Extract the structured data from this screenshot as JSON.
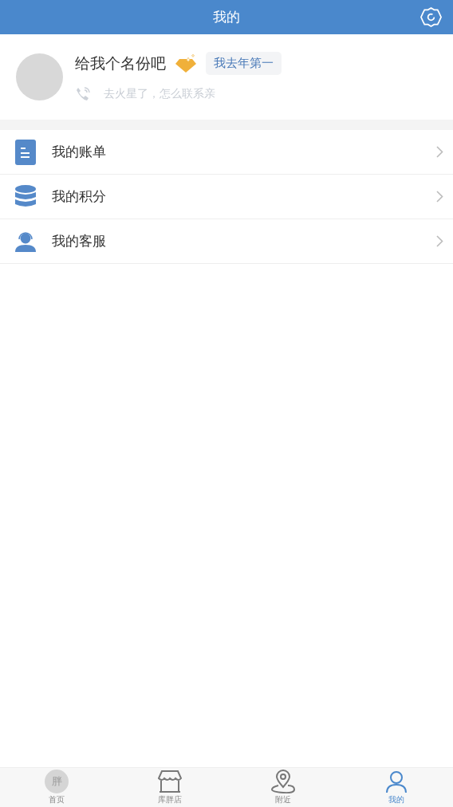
{
  "header": {
    "title": "我的"
  },
  "profile": {
    "name": "给我个名份吧",
    "badge": "我去年第一",
    "phone_hint": "去火星了，怎么联系亲"
  },
  "menu": [
    {
      "kind": "bill",
      "label": "我的账单"
    },
    {
      "kind": "points",
      "label": "我的积分"
    },
    {
      "kind": "service",
      "label": "我的客服"
    }
  ],
  "tabs": [
    {
      "kind": "home",
      "label": "首页",
      "logo": "胖",
      "selected": false
    },
    {
      "kind": "store",
      "label": "库胖店",
      "selected": false
    },
    {
      "kind": "nearby",
      "label": "附近",
      "selected": false
    },
    {
      "kind": "me",
      "label": "我的",
      "selected": true
    }
  ]
}
